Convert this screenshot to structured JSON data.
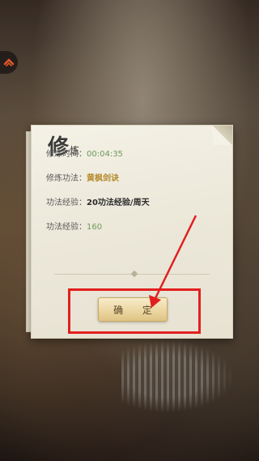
{
  "dialog": {
    "title_main": "修",
    "title_sub": "炼",
    "rows": [
      {
        "label": "修炼时间：",
        "value": "00:04:35"
      },
      {
        "label": "修炼功法：",
        "value": "黄枫剑诀"
      },
      {
        "label": "功法经验：",
        "value": "20功法经验/周天"
      },
      {
        "label": "功法经验：",
        "value": "160"
      }
    ],
    "confirm_label": "确 定"
  },
  "colors": {
    "highlight": "#e21f1f",
    "value_green": "#6f9a5a",
    "value_gold": "#b58a2c"
  },
  "icons": {
    "corner": "collapse-chevron-icon",
    "annotation": "red-arrow"
  }
}
